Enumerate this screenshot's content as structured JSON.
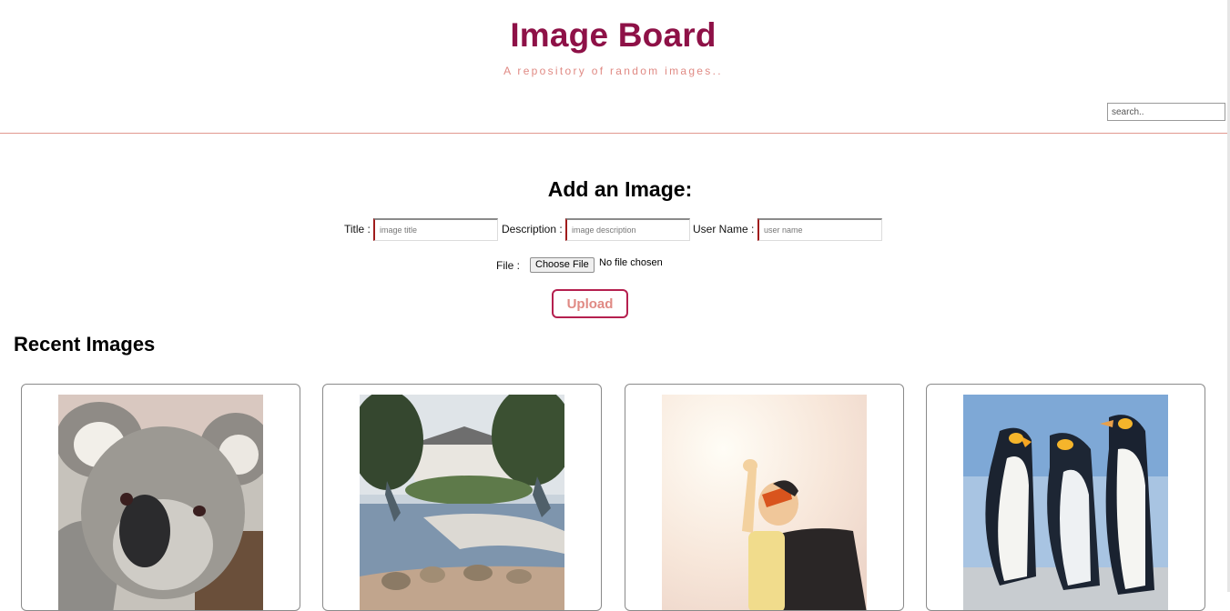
{
  "header": {
    "title": "Image Board",
    "subtitle": "A repository of random images..",
    "search_placeholder": "search.."
  },
  "form": {
    "heading": "Add an Image:",
    "title_label": "Title :",
    "title_placeholder": "image title",
    "description_label": "Description :",
    "description_placeholder": "image description",
    "username_label": "User Name :",
    "username_placeholder": "user name",
    "file_label": "File :",
    "file_button": "Choose File",
    "file_status": "No file chosen",
    "upload_label": "Upload"
  },
  "recent": {
    "heading": "Recent Images",
    "images": [
      {
        "subject": "koala"
      },
      {
        "subject": "japanese-garden"
      },
      {
        "subject": "child-superhero"
      },
      {
        "subject": "penguins"
      }
    ]
  },
  "colors": {
    "title": "#8e1147",
    "subtitle": "#e08a84",
    "divider": "#e2988f",
    "upload_border": "#b5204f",
    "input_accent": "#a01c1c"
  }
}
